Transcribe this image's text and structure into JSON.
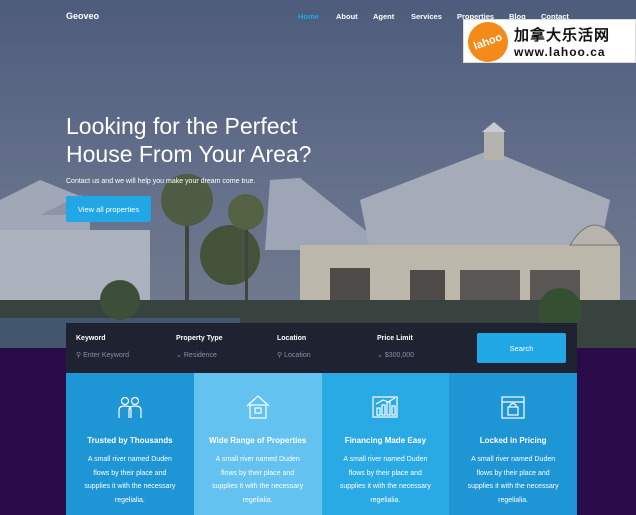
{
  "nav": {
    "brand": "Geoveo",
    "links": [
      "Home",
      "About",
      "Agent",
      "Services",
      "Properties",
      "Blog",
      "Contact"
    ]
  },
  "watermark": {
    "cn": "加拿大乐活网",
    "url": "www.lahoo.ca",
    "logo": "lahoo"
  },
  "hero": {
    "title": "Looking for the Perfect House From Your Area?",
    "subtitle": "Contact us and we will help you make your dream come true.",
    "button": "View all properties"
  },
  "search": {
    "fields": [
      {
        "label": "Keyword",
        "placeholder": "Enter Keyword",
        "icon": "search-icon"
      },
      {
        "label": "Property Type",
        "placeholder": "Residence",
        "icon": "chevron-down-icon"
      },
      {
        "label": "Location",
        "placeholder": "Location",
        "icon": "search-icon"
      },
      {
        "label": "Price Limit",
        "placeholder": "$300,000",
        "icon": "chevron-down-icon"
      }
    ],
    "button": "Search"
  },
  "features": [
    {
      "title": "Trusted by Thousands",
      "desc": "A small river named Duden flows by their place and supplies it with the necessary regelialia.",
      "bg": "#1e96d6",
      "icon": "people-icon"
    },
    {
      "title": "Wide Range of Properties",
      "desc": "A small river named Duden flows by their place and supplies it with the necessary regelialia.",
      "bg": "#63c2f0",
      "icon": "house-icon"
    },
    {
      "title": "Financing Made Easy",
      "desc": "A small river named Duden flows by their place and supplies it with the necessary regelialia.",
      "bg": "#2aaae5",
      "icon": "chart-icon"
    },
    {
      "title": "Locked in Pricing",
      "desc": "A small river named Duden flows by their place and supplies it with the necessary regelialia.",
      "bg": "#1e96d6",
      "icon": "lock-house-icon"
    }
  ],
  "colors": {
    "accent": "#21a7e6",
    "dark_bar": "#1f2230",
    "page_bg": "#2a0b4a"
  }
}
